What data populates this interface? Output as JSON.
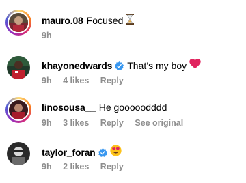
{
  "comments": [
    {
      "username": "mauro.08",
      "text": "Focused",
      "time": "9h",
      "verified": false,
      "emoji_icon": "hourglass-icon"
    },
    {
      "username": "khayonedwards",
      "text": "That’s my boy",
      "time": "9h",
      "likes": "4 likes",
      "reply": "Reply",
      "verified": true,
      "emoji_icon": "red-heart-icon"
    },
    {
      "username": "linosousa__",
      "text": "He gooooodddd",
      "time": "9h",
      "likes": "3 likes",
      "reply": "Reply",
      "see_original": "See original",
      "verified": false
    },
    {
      "username": "taylor_foran",
      "text": "",
      "time": "9h",
      "likes": "2 likes",
      "reply": "Reply",
      "verified": true,
      "emoji_icon": "heart-eyes-emoji-icon"
    }
  ],
  "colors": {
    "secondary_text": "#8e8e8e",
    "verified_blue": "#3897f0",
    "heart_red": "#e0245e"
  }
}
